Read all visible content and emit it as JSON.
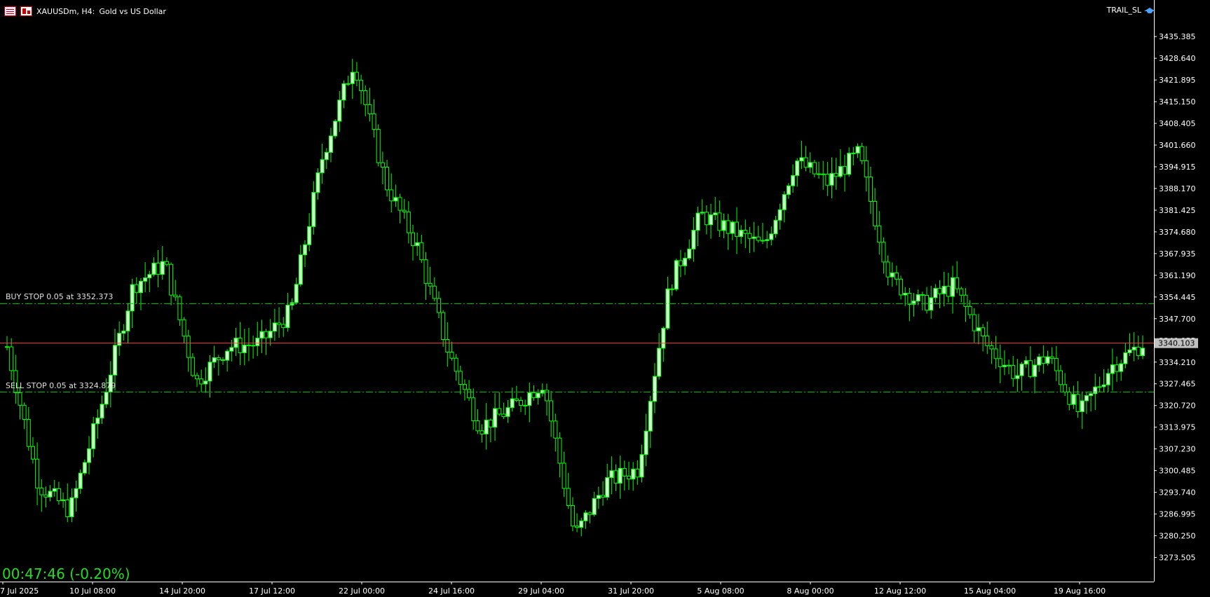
{
  "header": {
    "symbol": "XAUUSDm, H4:",
    "description": "Gold vs US Dollar",
    "icons": [
      "symbol-list-icon",
      "one-click-trading-icon"
    ]
  },
  "expert": {
    "name": "TRAIL_SL",
    "icon": "graduation-hat-icon"
  },
  "orders": {
    "buy_stop": {
      "label": "BUY STOP 0.05 at 3352.373",
      "price": 3352.373
    },
    "sell_stop": {
      "label": "SELL STOP 0.05 at 3324.879",
      "price": 3324.879
    }
  },
  "current_price": {
    "label": "3340.103",
    "value": 3340.103
  },
  "timer": "00:47:46 (-0.20%)",
  "colors": {
    "background": "#000000",
    "candle": "#00ff00",
    "bull_body": "#ccffcc",
    "order_line": "#00cc00",
    "bid_line": "#ff4040",
    "axis_text": "#ffffff",
    "timer": "#22dd22"
  },
  "chart_data": {
    "type": "candlestick",
    "symbol": "XAUUSDm",
    "timeframe": "H4",
    "y_tick_labels": [
      "3435.385",
      "3428.640",
      "3421.895",
      "3415.150",
      "3408.405",
      "3401.660",
      "3394.915",
      "3388.170",
      "3381.425",
      "3374.680",
      "3367.935",
      "3361.190",
      "3354.445",
      "3347.700",
      "3340.955",
      "3334.210",
      "3327.465",
      "3320.720",
      "3313.975",
      "3307.230",
      "3300.485",
      "3293.740",
      "3286.995",
      "3280.250",
      "3273.505"
    ],
    "x_tick_labels": [
      "7 Jul 2025",
      "10 Jul 08:00",
      "14 Jul 20:00",
      "17 Jul 12:00",
      "22 Jul 00:00",
      "24 Jul 16:00",
      "29 Jul 04:00",
      "31 Jul 20:00",
      "5 Aug 08:00",
      "8 Aug 00:00",
      "12 Aug 12:00",
      "15 Aug 04:00",
      "19 Aug 16:00"
    ],
    "ylim": [
      3266,
      3445
    ],
    "anchors": [
      [
        "7 Jul 2025",
        3339
      ],
      [
        "8 Jul",
        3296
      ],
      [
        "9 Jul",
        3288
      ],
      [
        "10 Jul 08:00",
        3321
      ],
      [
        "11 Jul",
        3358
      ],
      [
        "14 Jul",
        3365
      ],
      [
        "14 Jul 20:00",
        3328
      ],
      [
        "16 Jul",
        3339
      ],
      [
        "17 Jul 12:00",
        3340
      ],
      [
        "18 Jul",
        3350
      ],
      [
        "21 Jul",
        3398
      ],
      [
        "22 Jul 00:00",
        3428
      ],
      [
        "23 Jul",
        3390
      ],
      [
        "24 Jul",
        3370
      ],
      [
        "24 Jul 16:00",
        3337
      ],
      [
        "25 Jul",
        3314
      ],
      [
        "29 Jul 04:00",
        3320
      ],
      [
        "30 Jul",
        3328
      ],
      [
        "30 Jul 12:00",
        3280
      ],
      [
        "31 Jul",
        3297
      ],
      [
        "31 Jul 20:00",
        3301
      ],
      [
        "1 Aug",
        3358
      ],
      [
        "4 Aug",
        3380
      ],
      [
        "5 Aug 08:00",
        3375
      ],
      [
        "6 Aug",
        3370
      ],
      [
        "7 Aug",
        3397
      ],
      [
        "8 Aug 00:00",
        3390
      ],
      [
        "8 Aug 12:00",
        3399
      ],
      [
        "11 Aug",
        3360
      ],
      [
        "12 Aug 12:00",
        3352
      ],
      [
        "13 Aug",
        3358
      ],
      [
        "14 Aug",
        3340
      ],
      [
        "15 Aug 04:00",
        3330
      ],
      [
        "18 Aug",
        3336
      ],
      [
        "19 Aug",
        3318
      ],
      [
        "19 Aug 16:00",
        3333
      ],
      [
        "20 Aug",
        3340
      ]
    ],
    "candle_count": 264
  }
}
